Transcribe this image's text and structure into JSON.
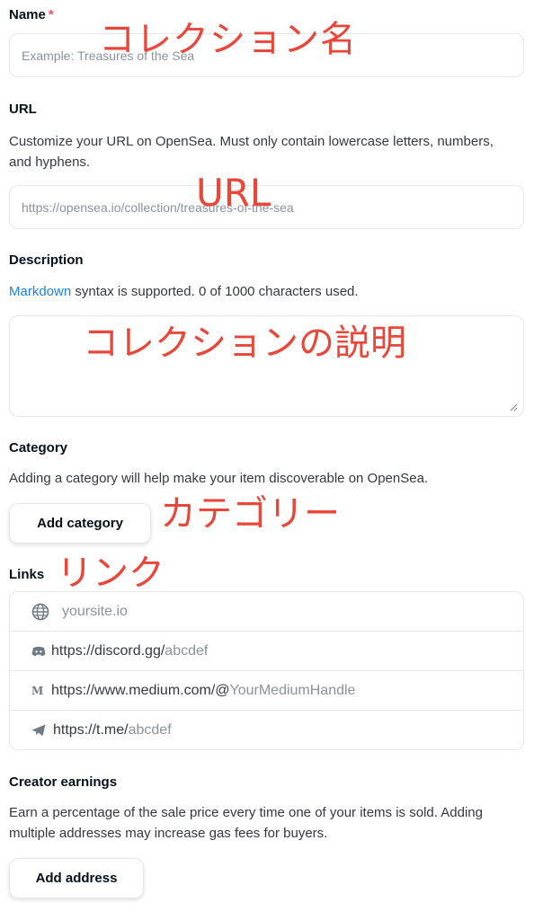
{
  "name": {
    "label": "Name",
    "required_mark": "*",
    "placeholder": "Example: Treasures of the Sea",
    "annotation": "コレクション名"
  },
  "url": {
    "label": "URL",
    "description": "Customize your URL on OpenSea. Must only contain lowercase letters, numbers, and hyphens.",
    "placeholder": "https://opensea.io/collection/treasures-of-the-sea",
    "annotation": "URL"
  },
  "description": {
    "label": "Description",
    "markdown_link": "Markdown",
    "help_text": " syntax is supported. 0 of 1000 characters used.",
    "annotation": "コレクションの説明"
  },
  "category": {
    "label": "Category",
    "description": "Adding a category will help make your item discoverable on OpenSea.",
    "button": "Add category",
    "annotation": "カテゴリー"
  },
  "links": {
    "label": "Links",
    "annotation": "リンク",
    "rows": [
      {
        "icon": "globe-icon",
        "prefix": "",
        "placeholder": "yoursite.io"
      },
      {
        "icon": "discord-icon",
        "prefix": "https://discord.gg/",
        "placeholder": "abcdef"
      },
      {
        "icon": "medium-icon",
        "prefix": "https://www.medium.com/@",
        "placeholder": "YourMediumHandle"
      },
      {
        "icon": "telegram-icon",
        "prefix": "https://t.me/",
        "placeholder": "abcdef"
      }
    ]
  },
  "earnings": {
    "label": "Creator earnings",
    "description": "Earn a percentage of the sale price every time one of your items is sold. Adding multiple addresses may increase gas fees for buyers.",
    "button": "Add address"
  },
  "colors": {
    "annotation": "#e8473a",
    "link": "#2081e2",
    "required": "#eb5757"
  }
}
